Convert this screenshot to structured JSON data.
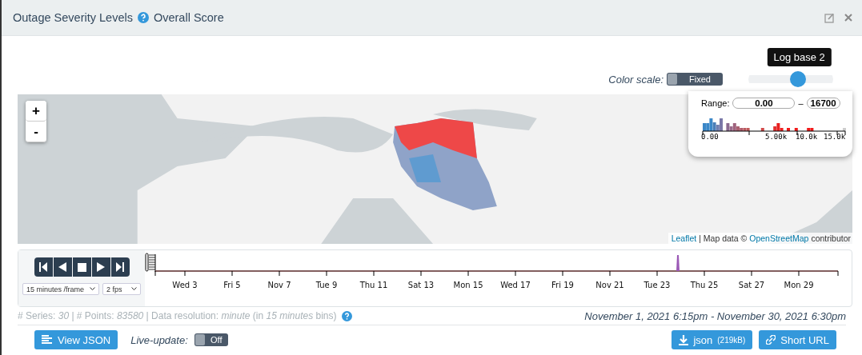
{
  "header": {
    "title": "Outage Severity Levels",
    "subtitle": "Overall Score"
  },
  "color_scale": {
    "label": "Color scale:",
    "toggle": "Fixed"
  },
  "scale_slider": {
    "tooltip": "Log base 2",
    "level": 0.6
  },
  "map": {
    "zoom_in": "+",
    "zoom_out": "-",
    "legend": {
      "range_label": "Range:",
      "min": "0.00",
      "separator": "–",
      "max": "16700",
      "axis_ticks": [
        "0.00",
        "5.00k",
        "10.0k",
        "15.0k"
      ]
    },
    "attribution": {
      "link": "Leaflet",
      "text": "| Map data ©",
      "source": "OpenStreetMap",
      "suffix": "contributor"
    }
  },
  "player": {
    "frame_step": "15 minutes /frame",
    "fps": "2 fps"
  },
  "timeline": {
    "ticks": [
      "Wed 3",
      "Fri 5",
      "Nov 7",
      "Tue 9",
      "Thu 11",
      "Sat 13",
      "Mon 15",
      "Wed 17",
      "Fri 19",
      "Nov 21",
      "Tue 23",
      "Thu 25",
      "Sat 27",
      "Mon 29"
    ]
  },
  "info": {
    "text": "# Series: *30* | # Points: *83580* | Data resolution: *minute* (in *15 minutes* bins)",
    "date_range": "November 1, 2021 6:15pm - November 30, 2021 6:30pm"
  },
  "footer": {
    "view_json": "View JSON",
    "live_label": "Live-update:",
    "live_toggle": "Off",
    "download": "json",
    "download_size": "(219kB)",
    "short_url": "Short URL"
  }
}
